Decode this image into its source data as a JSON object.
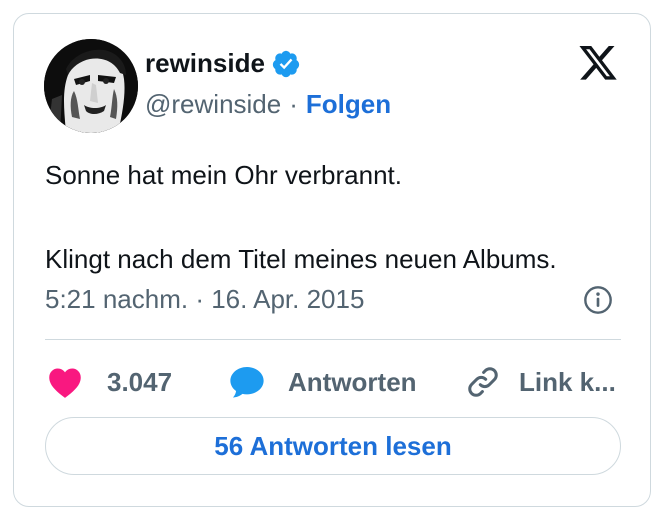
{
  "author": {
    "display_name": "rewinside",
    "handle": "@rewinside",
    "separator": "·",
    "follow_label": "Folgen"
  },
  "tweet": {
    "line1": "Sonne hat mein Ohr verbrannt.",
    "line2": "Klingt nach dem Titel meines neuen Albums.",
    "timestamp": "5:21 nachm. · 16. Apr. 2015"
  },
  "actions": {
    "likes_count": "3.047",
    "reply_label": "Antworten",
    "copy_link_label": "Link k..."
  },
  "read_replies_label": "56 Antworten lesen",
  "colors": {
    "accent": "#1d6fd8",
    "like": "#f91880",
    "reply": "#1d9bf0",
    "muted": "#536471",
    "border": "#cfd9de"
  },
  "icons": [
    "verified-badge-icon",
    "x-logo-icon",
    "info-icon",
    "heart-icon",
    "reply-bubble-icon",
    "link-icon"
  ]
}
